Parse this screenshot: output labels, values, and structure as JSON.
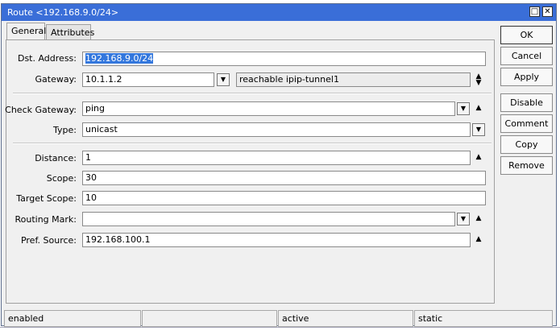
{
  "window": {
    "title": "Route <192.168.9.0/24>"
  },
  "tabs": [
    {
      "label": "General"
    },
    {
      "label": "Attributes"
    }
  ],
  "form": {
    "dst_address": {
      "label": "Dst. Address:",
      "value": "192.168.9.0/24"
    },
    "gateway": {
      "label": "Gateway:",
      "value": "10.1.1.2",
      "status": "reachable ipip-tunnel1"
    },
    "check_gateway": {
      "label": "Check Gateway:",
      "value": "ping"
    },
    "type": {
      "label": "Type:",
      "value": "unicast"
    },
    "distance": {
      "label": "Distance:",
      "value": "1"
    },
    "scope": {
      "label": "Scope:",
      "value": "30"
    },
    "target_scope": {
      "label": "Target Scope:",
      "value": "10"
    },
    "routing_mark": {
      "label": "Routing Mark:",
      "value": ""
    },
    "pref_source": {
      "label": "Pref. Source:",
      "value": "192.168.100.1"
    }
  },
  "buttons": {
    "ok": "OK",
    "cancel": "Cancel",
    "apply": "Apply",
    "disable": "Disable",
    "comment": "Comment",
    "copy": "Copy",
    "remove": "Remove"
  },
  "statusbar": [
    "enabled",
    "",
    "active",
    "static"
  ]
}
